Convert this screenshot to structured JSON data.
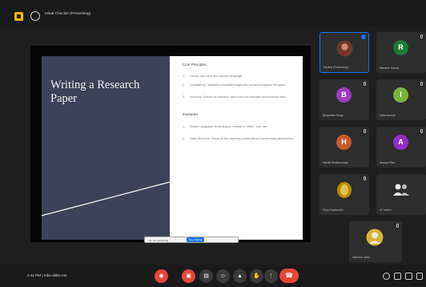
{
  "meeting": {
    "title": "Initial Checkin (Presenting)",
    "time": "4:41 PM",
    "meeting_code": "mbe-ddbn-rus"
  },
  "slide": {
    "title": "Writing a Research Paper",
    "sections": [
      {
        "heading": "Core Principles",
        "items": [
          "Clarity: Use clear and concise language.",
          "Consistency: Maintain a consistent style and format throughout the paper.",
          "Accuracy: Ensure all research references are accurate and properly cited."
        ]
      },
      {
        "heading": "Examples",
        "items": [
          "Simple Language: Avoid jargon; instead of 'utilize,' use 'use.'",
          "Clear Structure: Focus on the essential points without unnecessary distractions."
        ]
      }
    ]
  },
  "share_bar": {
    "text": "You are presenting",
    "stop_label": "Stop sharing"
  },
  "participants": [
    {
      "name": "Nodeal (Presenting)",
      "initial": "",
      "color": "#a9623d",
      "photo": true,
      "active": true
    },
    {
      "name": "Ramesh Kumar",
      "initial": "R",
      "color": "#1f7a3a",
      "photo": false,
      "active": false
    },
    {
      "name": "Bhupinder Singh",
      "initial": "B",
      "color": "#9c3fc0",
      "photo": false,
      "active": false
    },
    {
      "name": "Indra Kumari",
      "initial": "I",
      "color": "#7ab33a",
      "photo": false,
      "active": false
    },
    {
      "name": "Hardik Bhattacharya",
      "initial": "H",
      "color": "#c75a2a",
      "photo": false,
      "active": false
    },
    {
      "name": "Ananya Rao",
      "initial": "A",
      "color": "#8e2fc6",
      "photo": false,
      "active": false
    },
    {
      "name": "Priya Deshmukh",
      "initial": "",
      "color": "#b58a00",
      "photo": true,
      "active": false
    },
    {
      "name": "47 others",
      "initial": "",
      "color": "#3a3a3a",
      "photo": false,
      "active": false
    },
    {
      "name": "Santosh Joshi",
      "initial": "",
      "color": "#d9b43a",
      "photo": true,
      "active": false
    }
  ],
  "icons": {
    "meeting": "meeting-icon",
    "mic": "mic-icon",
    "camera": "camera-icon",
    "captions": "captions-icon",
    "emoji": "emoji-icon",
    "present": "present-icon",
    "more": "more-icon",
    "end_call": "end-call-icon",
    "info": "info-icon",
    "people": "people-icon",
    "chat": "chat-icon"
  },
  "colors": {
    "accent": "#1a73e8",
    "danger": "#e3453b",
    "slide_panel": "#3c4257"
  }
}
